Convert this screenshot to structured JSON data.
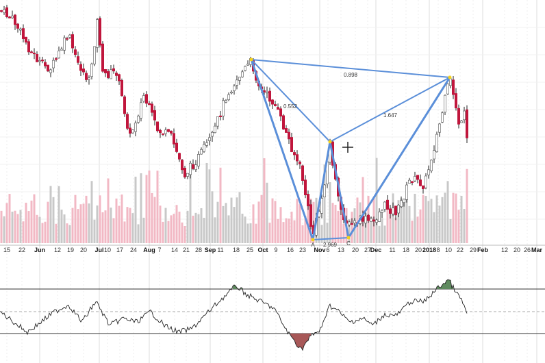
{
  "chart_data": {
    "type": "candlestick",
    "title": "",
    "x_ticks": [
      {
        "t": "15",
        "x": 10
      },
      {
        "t": "22",
        "x": 32
      },
      {
        "t": "Jun",
        "x": 58,
        "m": 1
      },
      {
        "t": "12",
        "x": 84
      },
      {
        "t": "19",
        "x": 103
      },
      {
        "t": "20",
        "x": 122
      },
      {
        "t": "Jul",
        "x": 145,
        "m": 1
      },
      {
        "t": "10",
        "x": 157
      },
      {
        "t": "17",
        "x": 175
      },
      {
        "t": "24",
        "x": 195
      },
      {
        "t": "Aug",
        "x": 218,
        "m": 1
      },
      {
        "t": "7",
        "x": 233
      },
      {
        "t": "14",
        "x": 255
      },
      {
        "t": "21",
        "x": 272
      },
      {
        "t": "28",
        "x": 290
      },
      {
        "t": "Sep",
        "x": 307,
        "m": 1
      },
      {
        "t": "11",
        "x": 322
      },
      {
        "t": "18",
        "x": 345
      },
      {
        "t": "25",
        "x": 365
      },
      {
        "t": "Oct",
        "x": 384,
        "m": 1
      },
      {
        "t": "9",
        "x": 403
      },
      {
        "t": "16",
        "x": 424
      },
      {
        "t": "23",
        "x": 442
      },
      {
        "t": "Nov",
        "x": 467,
        "m": 1
      },
      {
        "t": "6",
        "x": 479
      },
      {
        "t": "13",
        "x": 498
      },
      {
        "t": "20",
        "x": 519
      },
      {
        "t": "27",
        "x": 537
      },
      {
        "t": "Dec",
        "x": 549,
        "m": 1
      },
      {
        "t": "11",
        "x": 573
      },
      {
        "t": "18",
        "x": 593
      },
      {
        "t": "20",
        "x": 611
      },
      {
        "t": "2018",
        "x": 627,
        "m": 1
      },
      {
        "t": "8",
        "x": 640
      },
      {
        "t": "10",
        "x": 655
      },
      {
        "t": "22",
        "x": 672
      },
      {
        "t": "29",
        "x": 691
      },
      {
        "t": "Feb",
        "x": 705,
        "m": 1
      },
      {
        "t": "12",
        "x": 737
      },
      {
        "t": "20",
        "x": 755
      },
      {
        "t": "26",
        "x": 770
      },
      {
        "t": "Mar",
        "x": 784,
        "m": 1
      }
    ],
    "price_keypoints": [
      [
        0,
        15
      ],
      [
        20,
        30
      ],
      [
        45,
        75
      ],
      [
        60,
        95
      ],
      [
        75,
        100
      ],
      [
        100,
        50
      ],
      [
        110,
        85
      ],
      [
        130,
        120
      ],
      [
        143,
        25
      ],
      [
        150,
        110
      ],
      [
        170,
        105
      ],
      [
        190,
        200
      ],
      [
        210,
        140
      ],
      [
        230,
        190
      ],
      [
        250,
        200
      ],
      [
        270,
        255
      ],
      [
        290,
        230
      ],
      [
        310,
        200
      ],
      [
        330,
        140
      ],
      [
        350,
        110
      ],
      [
        367,
        90
      ],
      [
        380,
        130
      ],
      [
        400,
        150
      ],
      [
        420,
        200
      ],
      [
        440,
        250
      ],
      [
        457,
        345
      ],
      [
        470,
        290
      ],
      [
        482,
        210
      ],
      [
        495,
        300
      ],
      [
        509,
        330
      ],
      [
        530,
        320
      ],
      [
        545,
        325
      ],
      [
        560,
        300
      ],
      [
        580,
        310
      ],
      [
        600,
        260
      ],
      [
        620,
        270
      ],
      [
        640,
        190
      ],
      [
        657,
        115
      ],
      [
        665,
        150
      ],
      [
        672,
        190
      ],
      [
        680,
        160
      ],
      [
        683,
        230
      ]
    ],
    "oscillator_keypoints": [
      [
        0,
        455
      ],
      [
        20,
        470
      ],
      [
        40,
        485
      ],
      [
        60,
        470
      ],
      [
        80,
        455
      ],
      [
        100,
        445
      ],
      [
        120,
        470
      ],
      [
        140,
        440
      ],
      [
        160,
        475
      ],
      [
        180,
        465
      ],
      [
        200,
        470
      ],
      [
        220,
        455
      ],
      [
        240,
        475
      ],
      [
        260,
        485
      ],
      [
        280,
        480
      ],
      [
        300,
        460
      ],
      [
        320,
        440
      ],
      [
        345,
        417
      ],
      [
        360,
        430
      ],
      [
        380,
        440
      ],
      [
        400,
        450
      ],
      [
        420,
        485
      ],
      [
        440,
        510
      ],
      [
        455,
        490
      ],
      [
        470,
        480
      ],
      [
        480,
        445
      ],
      [
        495,
        455
      ],
      [
        510,
        470
      ],
      [
        530,
        465
      ],
      [
        545,
        475
      ],
      [
        560,
        460
      ],
      [
        580,
        460
      ],
      [
        600,
        440
      ],
      [
        620,
        440
      ],
      [
        640,
        420
      ],
      [
        655,
        408
      ],
      [
        665,
        425
      ],
      [
        675,
        440
      ],
      [
        683,
        460
      ]
    ],
    "pattern": {
      "points": [
        {
          "name": "X",
          "label": ""
        },
        {
          "name": "A",
          "label": "A"
        },
        {
          "name": "B",
          "label": ""
        },
        {
          "name": "C",
          "label": "C"
        },
        {
          "name": "D",
          "label": ""
        }
      ],
      "ratios": {
        "XB": "0.552",
        "AC": "2.969",
        "BD": "1.647",
        "XD": "0.898"
      }
    },
    "colors": {
      "down": "#c0163c",
      "up": "#ffffff",
      "vol_down": "#f2b8c4",
      "vol_up": "#c8c8c8",
      "pattern": "#5b8fd9",
      "osc_up": "#5f8a5f",
      "osc_down": "#a85858"
    }
  }
}
